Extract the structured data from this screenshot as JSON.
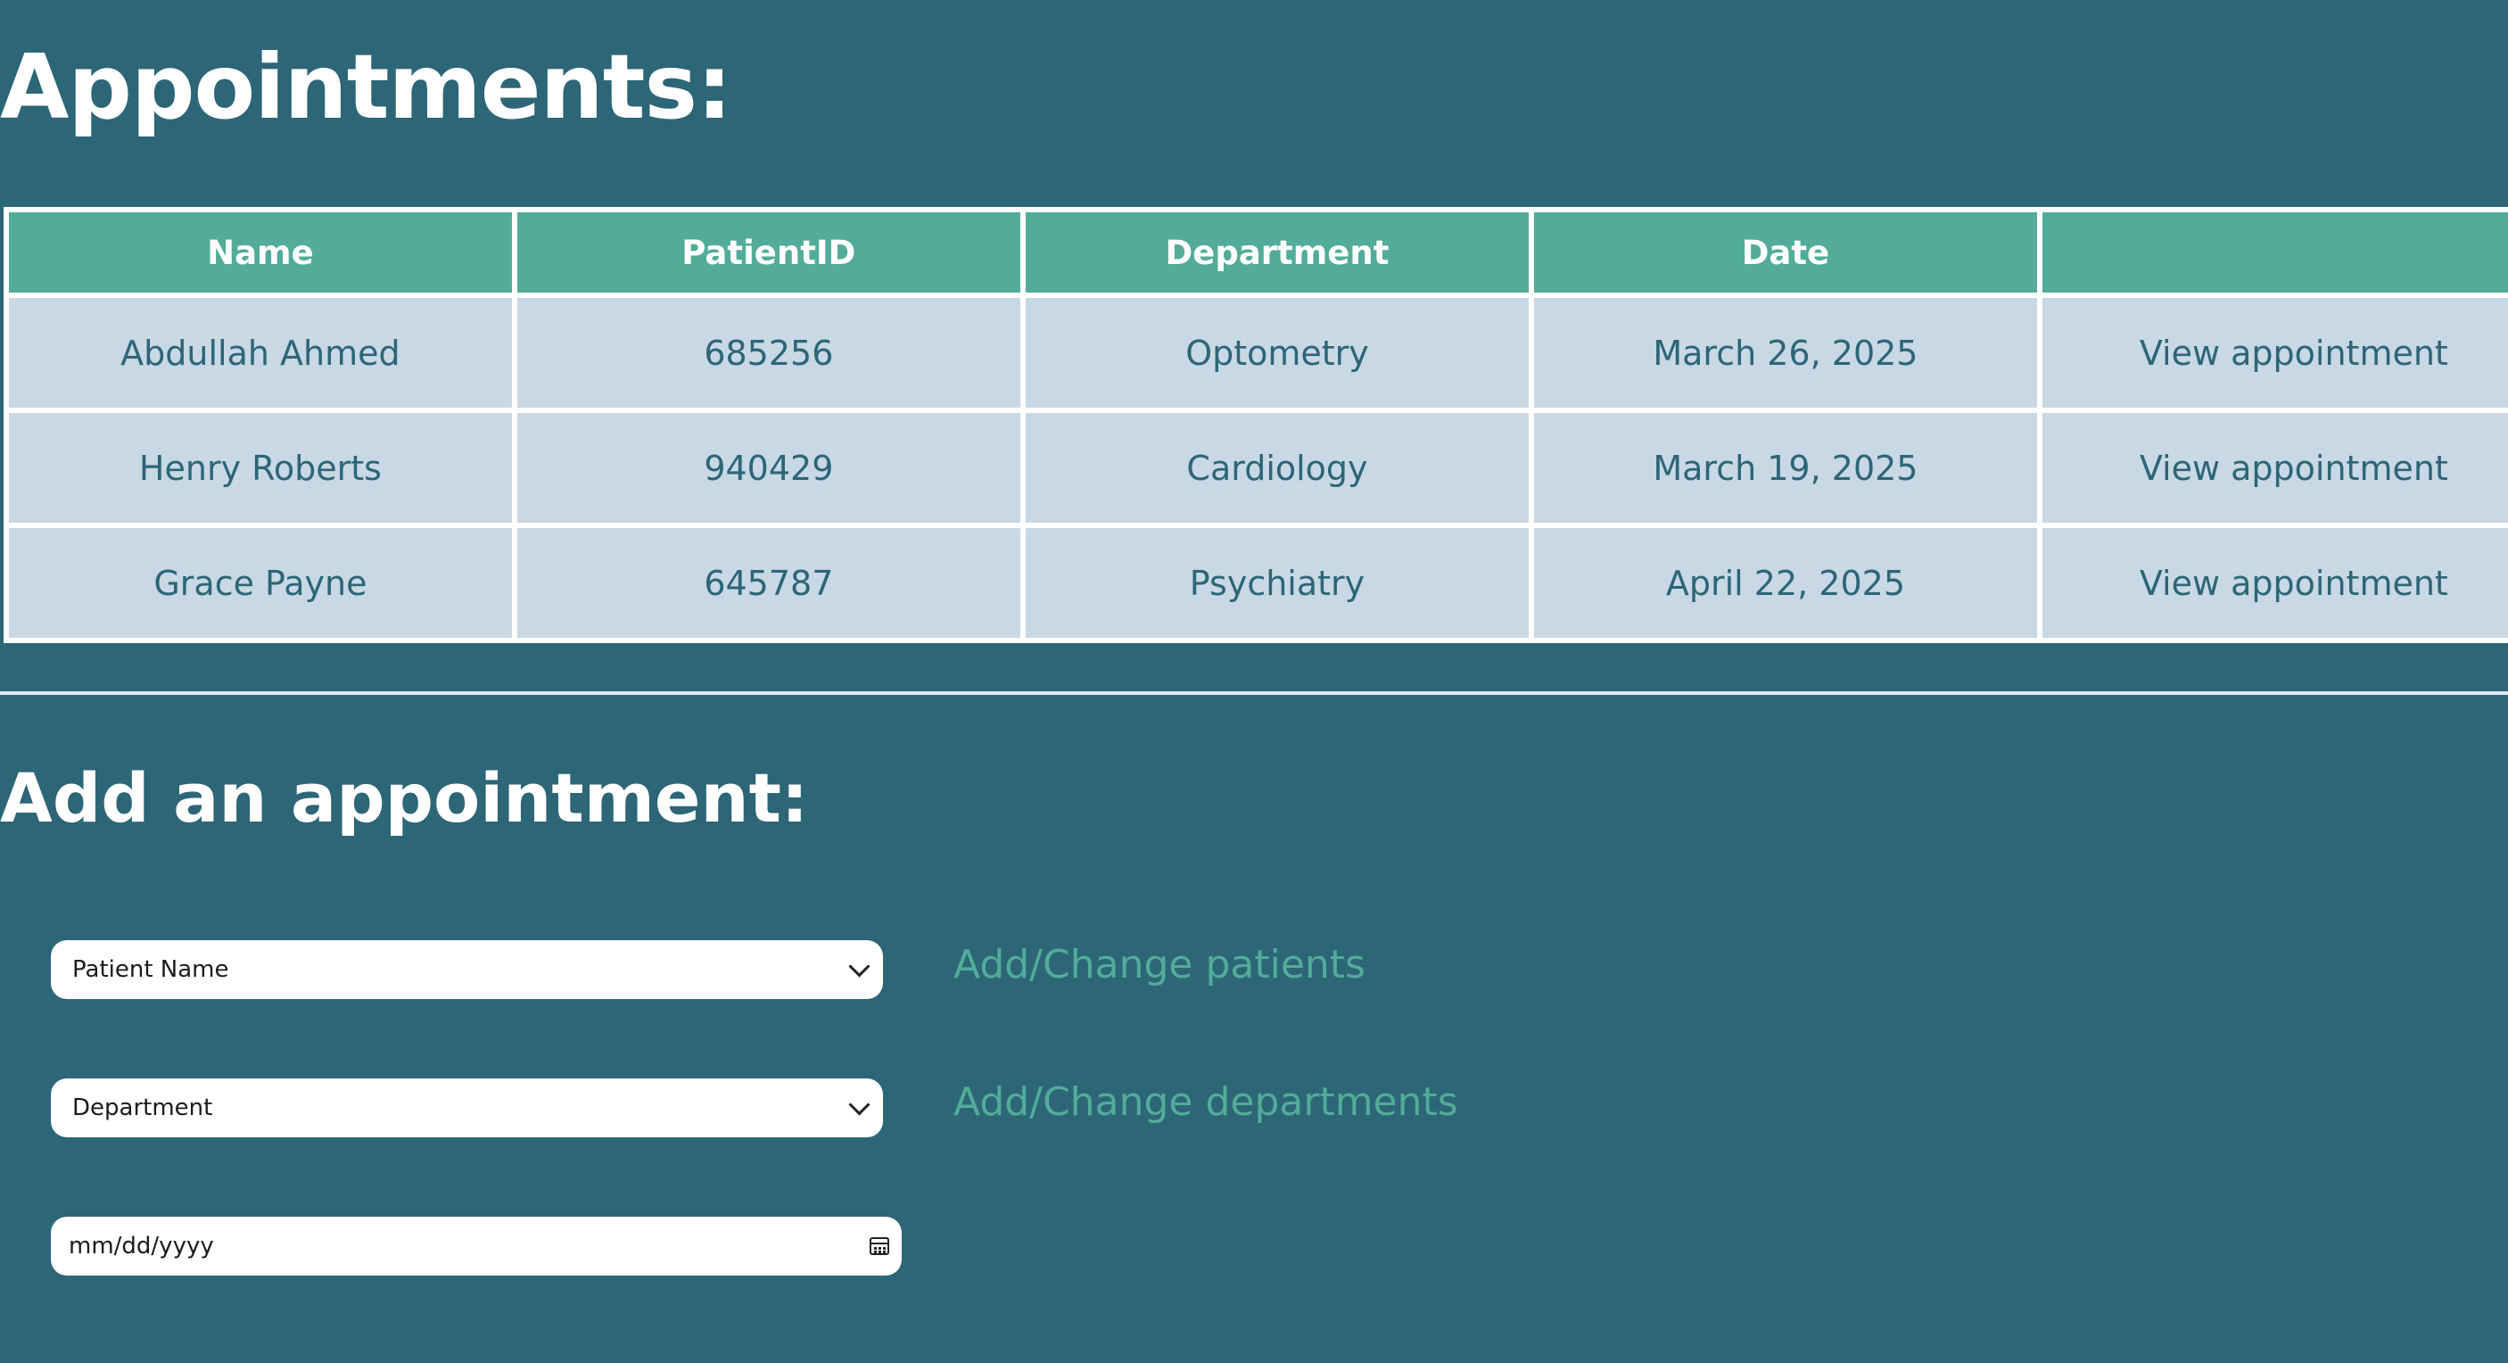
{
  "page": {
    "title": "Appointments:"
  },
  "appointments_table": {
    "headers": [
      "Name",
      "PatientID",
      "Department",
      "Date",
      ""
    ],
    "rows": [
      {
        "name": "Abdullah Ahmed",
        "patient_id": "685256",
        "department": "Optometry",
        "date": "March 26, 2025",
        "action": "View appointment"
      },
      {
        "name": "Henry Roberts",
        "patient_id": "940429",
        "department": "Cardiology",
        "date": "March 19, 2025",
        "action": "View appointment"
      },
      {
        "name": "Grace Payne",
        "patient_id": "645787",
        "department": "Psychiatry",
        "date": "April 22, 2025",
        "action": "View appointment"
      }
    ]
  },
  "add_appointment": {
    "title": "Add an appointment:",
    "patient_select": {
      "value": "Patient Name"
    },
    "patients_link": "Add/Change patients",
    "department_select": {
      "value": "Department"
    },
    "departments_link": "Add/Change departments",
    "date_input": {
      "placeholder": "mm/dd/yyyy"
    }
  },
  "icons": {
    "select_arrow": "chevron-down-icon",
    "date_picker": "calendar-icon"
  },
  "colors": {
    "background": "#2c6677",
    "header": "#52ac99",
    "cell": "#c8d8e4",
    "text_on_cell": "#2c6677",
    "link": "#52ac99"
  }
}
